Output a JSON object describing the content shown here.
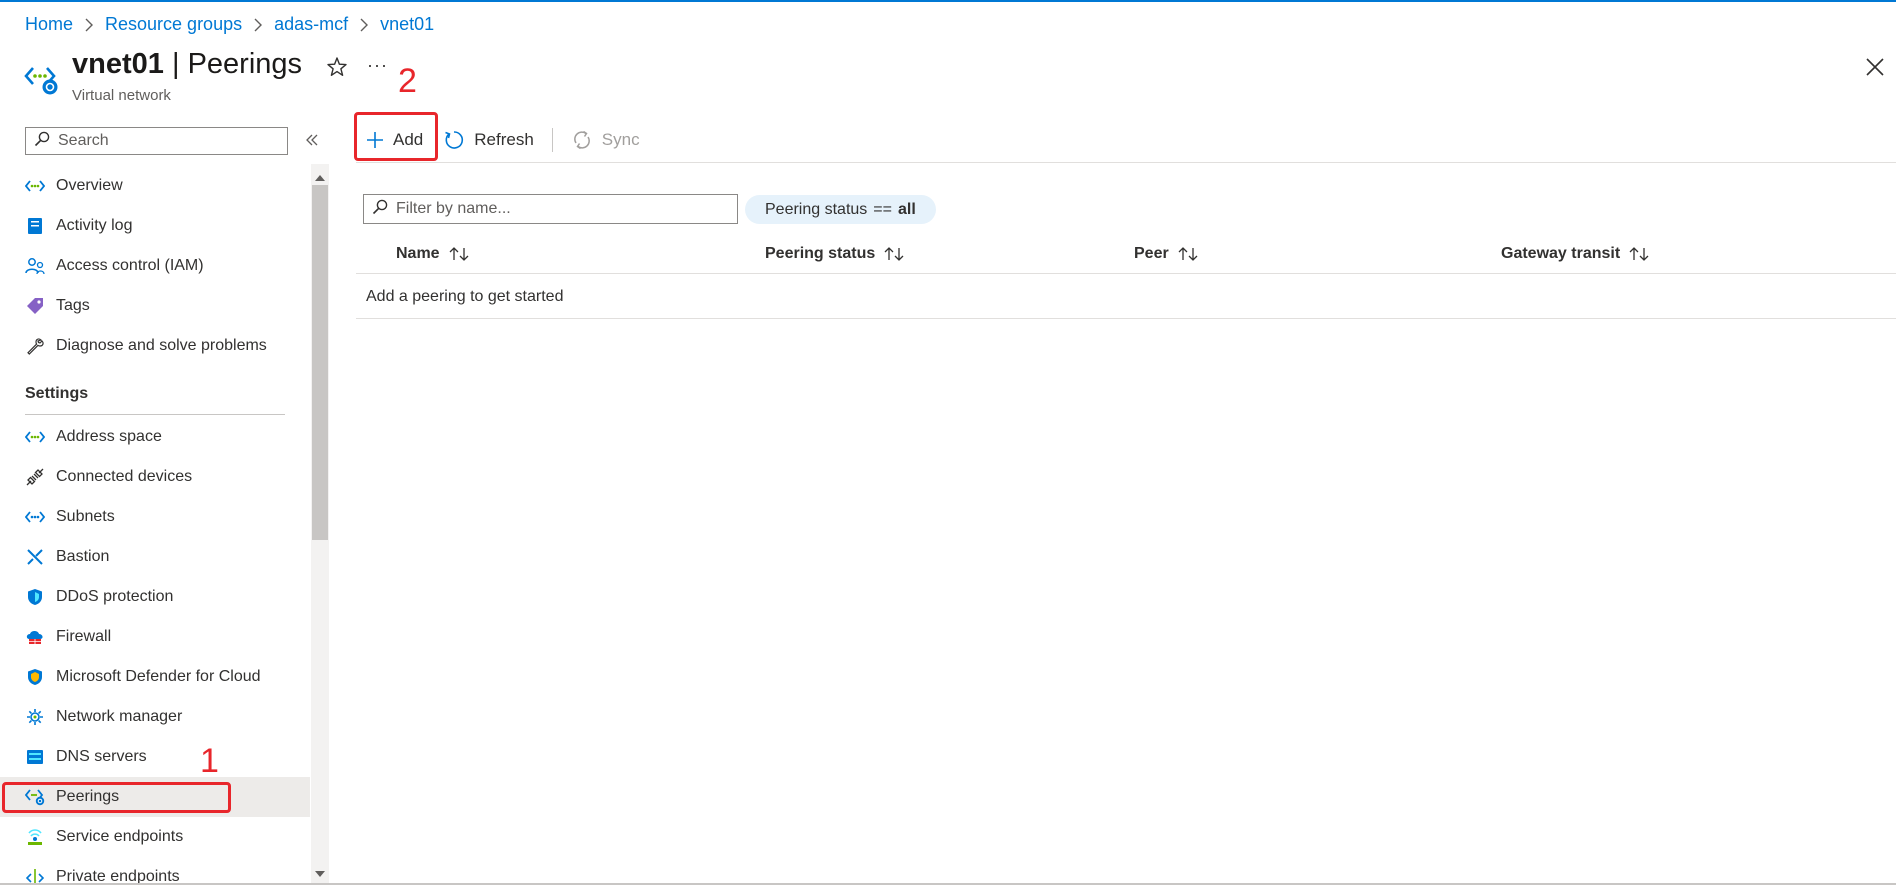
{
  "breadcrumb": [
    {
      "label": "Home"
    },
    {
      "label": "Resource groups"
    },
    {
      "label": "adas-mcf"
    },
    {
      "label": "vnet01"
    }
  ],
  "header": {
    "resource": "vnet01",
    "separator": "|",
    "page": "Peerings",
    "subtitle": "Virtual network",
    "more": "···"
  },
  "sidebar": {
    "search_placeholder": "Search",
    "section_settings": "Settings",
    "items": [
      {
        "label": "Overview",
        "icon": "vnet-icon"
      },
      {
        "label": "Activity log",
        "icon": "activity-log-icon"
      },
      {
        "label": "Access control (IAM)",
        "icon": "iam-icon"
      },
      {
        "label": "Tags",
        "icon": "tag-icon"
      },
      {
        "label": "Diagnose and solve problems",
        "icon": "wrench-icon"
      },
      {
        "label": "Address space",
        "icon": "vnet-icon"
      },
      {
        "label": "Connected devices",
        "icon": "plug-icon"
      },
      {
        "label": "Subnets",
        "icon": "vnet-icon"
      },
      {
        "label": "Bastion",
        "icon": "bastion-icon"
      },
      {
        "label": "DDoS protection",
        "icon": "shield-icon"
      },
      {
        "label": "Firewall",
        "icon": "firewall-icon"
      },
      {
        "label": "Microsoft Defender for Cloud",
        "icon": "defender-icon"
      },
      {
        "label": "Network manager",
        "icon": "network-manager-icon"
      },
      {
        "label": "DNS servers",
        "icon": "dns-icon"
      },
      {
        "label": "Peerings",
        "icon": "peering-icon",
        "selected": true
      },
      {
        "label": "Service endpoints",
        "icon": "service-endpoint-icon"
      },
      {
        "label": "Private endpoints",
        "icon": "private-endpoint-icon"
      }
    ]
  },
  "toolbar": {
    "add": "Add",
    "refresh": "Refresh",
    "sync": "Sync"
  },
  "filter": {
    "placeholder": "Filter by name...",
    "pill_key": "Peering status",
    "pill_op": "==",
    "pill_value": "all"
  },
  "table": {
    "columns": [
      "Name",
      "Peering status",
      "Peer",
      "Gateway transit"
    ],
    "empty_message": "Add a peering to get started"
  },
  "annotations": {
    "step1": "1",
    "step2": "2"
  },
  "colors": {
    "accent": "#0078d4",
    "annotation": "#e8262b",
    "selected_bg": "#edebe9",
    "pill_bg": "#e6f2fb"
  }
}
